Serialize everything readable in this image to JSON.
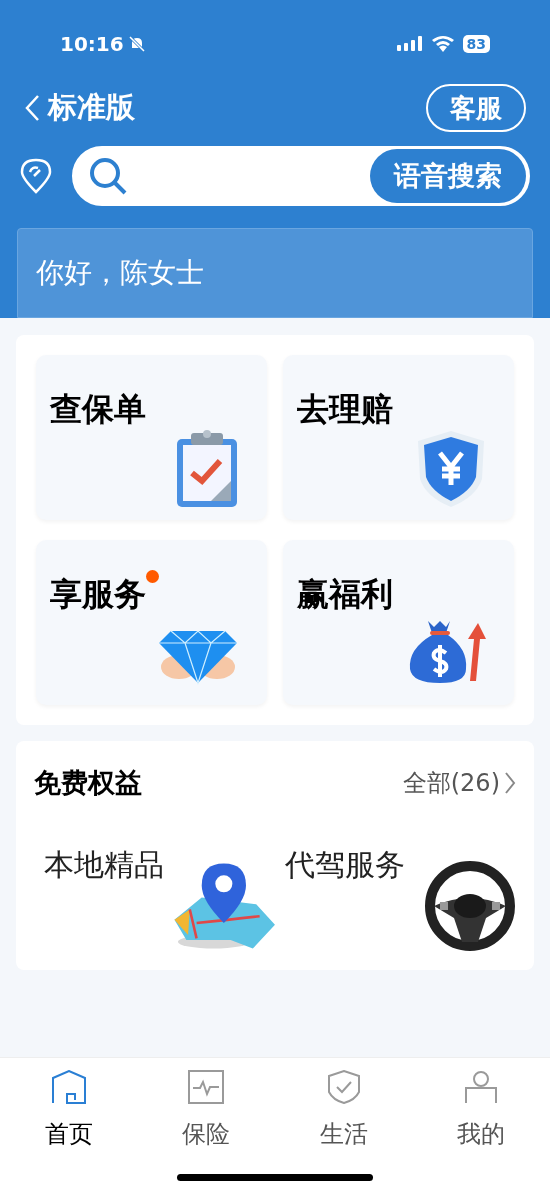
{
  "status_bar": {
    "time": "10:16",
    "battery": "83"
  },
  "header": {
    "title": "标准版",
    "service_button": "客服"
  },
  "search": {
    "voice_button": "语音搜索"
  },
  "greeting": "你好，陈女士",
  "quick_actions": [
    {
      "label": "查保单",
      "dot": false,
      "kind": "clipboard"
    },
    {
      "label": "去理赔",
      "dot": false,
      "kind": "shield"
    },
    {
      "label": "享服务",
      "dot": true,
      "kind": "diamond"
    },
    {
      "label": "赢福利",
      "dot": false,
      "kind": "moneybag"
    }
  ],
  "benefits": {
    "title": "免费权益",
    "more": "全部(26)",
    "items": [
      {
        "label": "本地精品",
        "kind": "map"
      },
      {
        "label": "代驾服务",
        "kind": "wheel"
      }
    ]
  },
  "tab_bar": [
    {
      "label": "首页",
      "selected": true,
      "kind": "home"
    },
    {
      "label": "保险",
      "selected": false,
      "kind": "pulse"
    },
    {
      "label": "生活",
      "selected": false,
      "kind": "shield"
    },
    {
      "label": "我的",
      "selected": false,
      "kind": "person"
    }
  ]
}
